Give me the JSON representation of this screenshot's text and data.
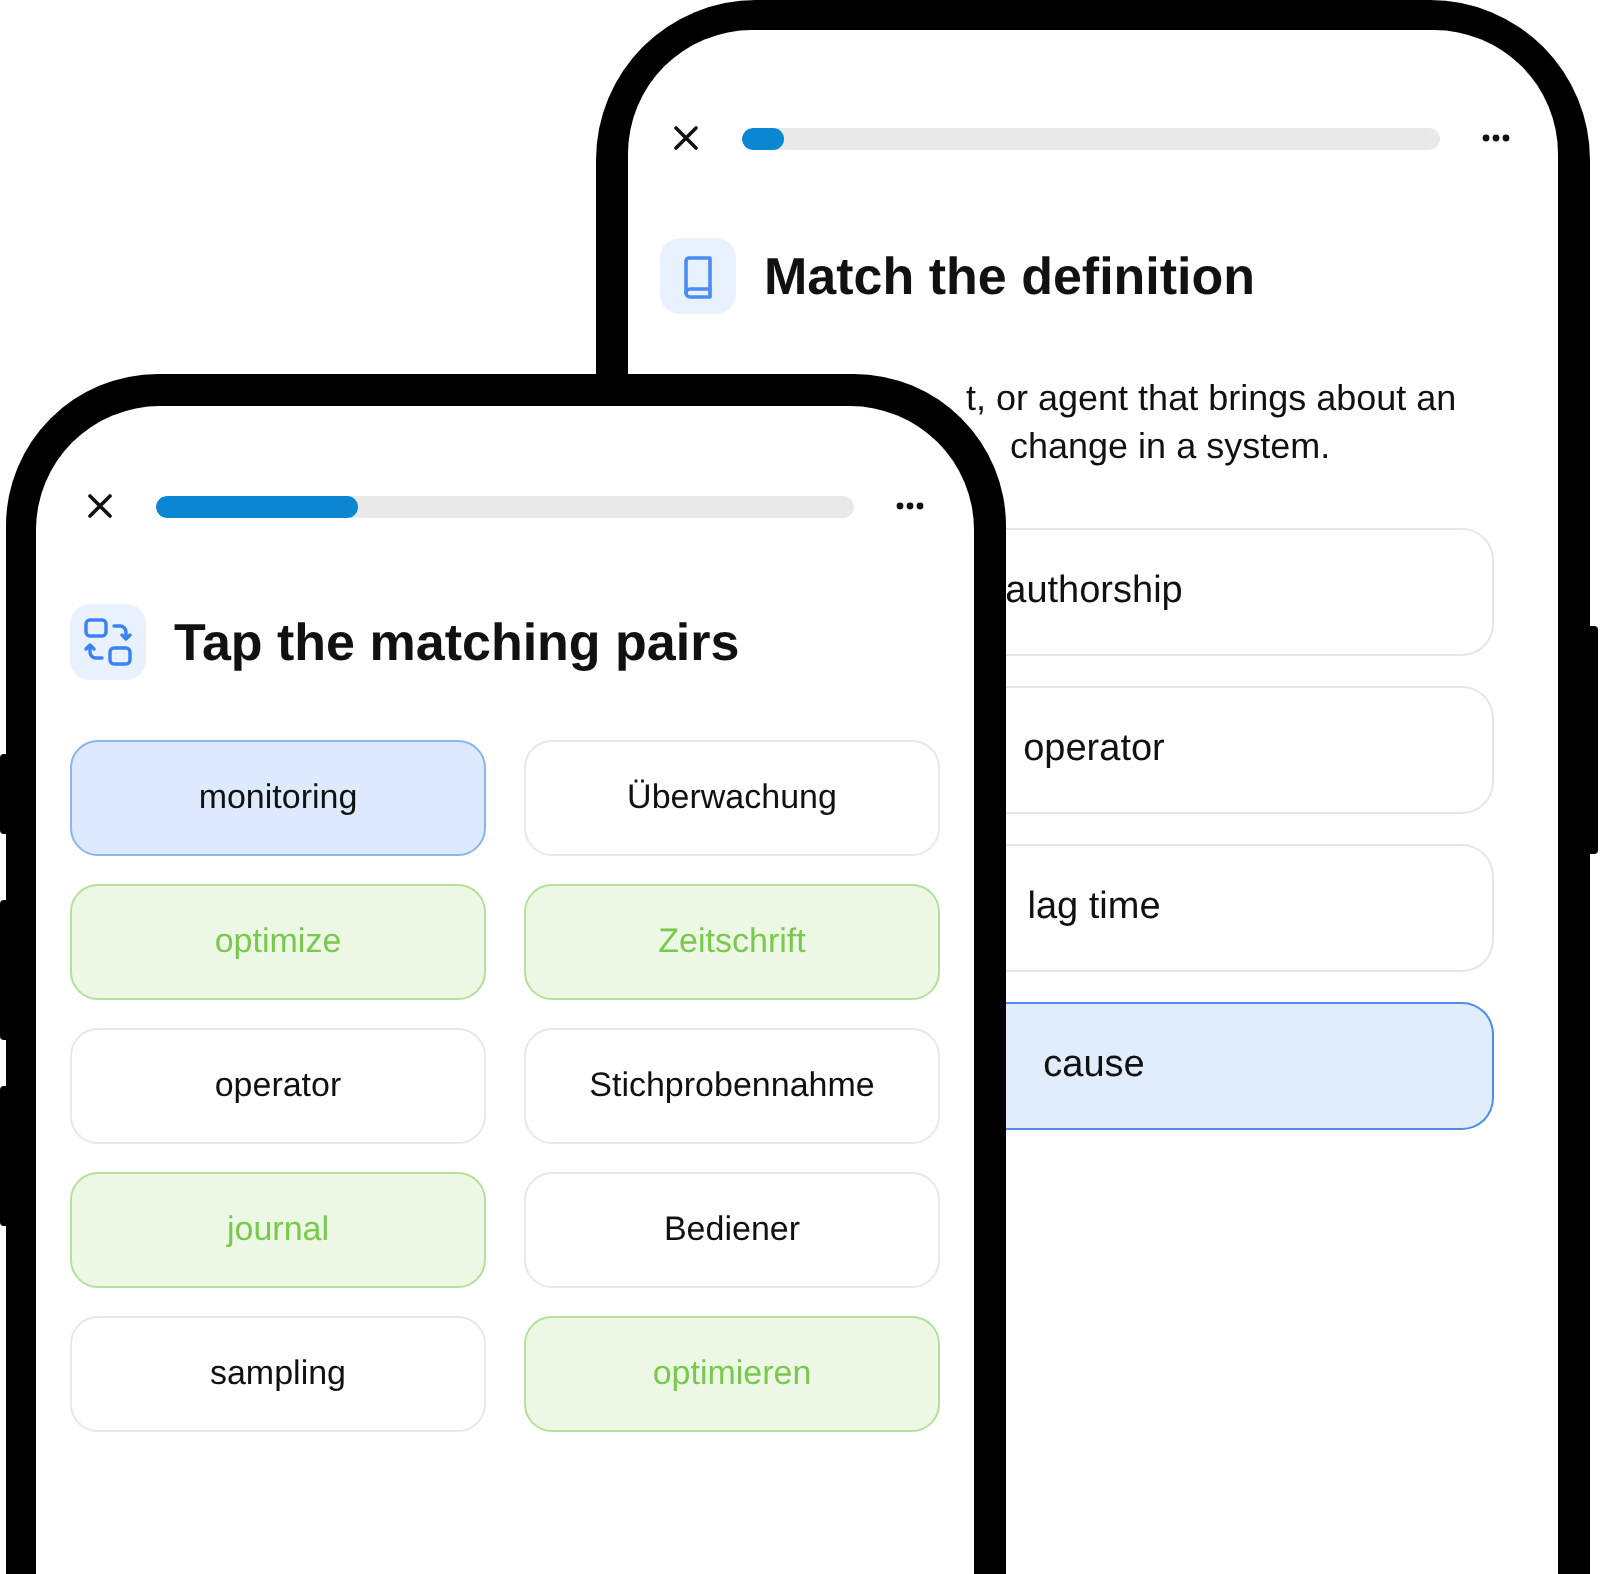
{
  "back_phone": {
    "progress": {
      "level": 0.06
    },
    "title": "Match the definition",
    "definition_lines": [
      "t, or agent that brings about an",
      "change in a system."
    ],
    "options": [
      {
        "label": "authorship",
        "selected": false
      },
      {
        "label": "operator",
        "selected": false
      },
      {
        "label": "lag time",
        "selected": false
      },
      {
        "label": "cause",
        "selected": true
      }
    ]
  },
  "front_phone": {
    "progress": {
      "level": 0.29
    },
    "title": "Tap the matching pairs",
    "tiles": [
      {
        "label": "monitoring",
        "selected": true,
        "matched": false
      },
      {
        "label": "Überwachung",
        "selected": false,
        "matched": false
      },
      {
        "label": "optimize",
        "selected": false,
        "matched": true
      },
      {
        "label": "Zeitschrift",
        "selected": false,
        "matched": true
      },
      {
        "label": "operator",
        "selected": false,
        "matched": false
      },
      {
        "label": "Stichprobennahme",
        "selected": false,
        "matched": false
      },
      {
        "label": "journal",
        "selected": false,
        "matched": true
      },
      {
        "label": "Bediener",
        "selected": false,
        "matched": false
      },
      {
        "label": "sampling",
        "selected": false,
        "matched": false
      },
      {
        "label": "optimieren",
        "selected": false,
        "matched": true
      }
    ]
  }
}
